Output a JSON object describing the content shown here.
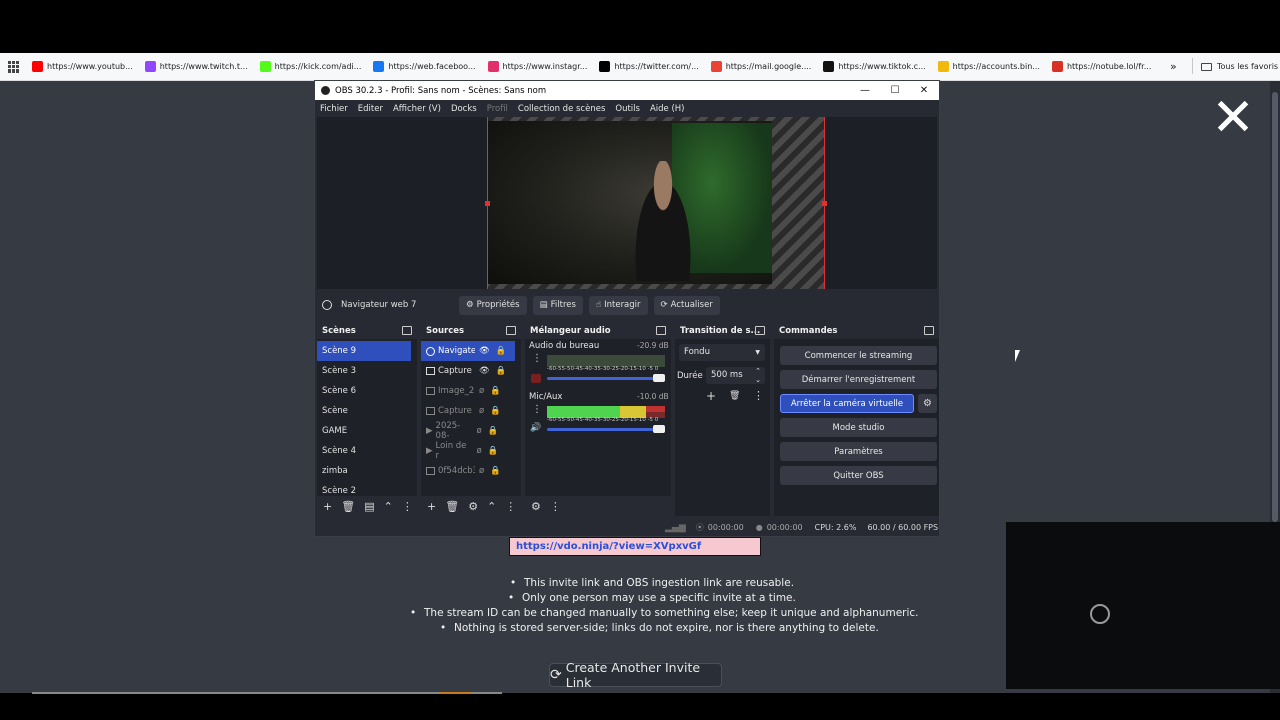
{
  "bookmarks": [
    {
      "label": "https://www.youtub...",
      "icon": "youtube-icon",
      "color": "#ff0000"
    },
    {
      "label": "https://www.twitch.t...",
      "icon": "twitch-icon",
      "color": "#9146ff"
    },
    {
      "label": "https://kick.com/adi...",
      "icon": "kick-icon",
      "color": "#53fc18"
    },
    {
      "label": "https://web.faceboo...",
      "icon": "facebook-icon",
      "color": "#1877f2"
    },
    {
      "label": "https://www.instagr...",
      "icon": "instagram-icon",
      "color": "#e1306c"
    },
    {
      "label": "https://twitter.com/...",
      "icon": "x-icon",
      "color": "#000000"
    },
    {
      "label": "https://mail.google....",
      "icon": "gmail-icon",
      "color": "#ea4335"
    },
    {
      "label": "https://www.tiktok.c...",
      "icon": "tiktok-icon",
      "color": "#111111"
    },
    {
      "label": "https://accounts.bin...",
      "icon": "binance-icon",
      "color": "#f0b90b"
    },
    {
      "label": "https://notube.lol/fr...",
      "icon": "notube-icon",
      "color": "#d93025"
    }
  ],
  "bookmarks_more": "»",
  "all_bookmarks": "Tous les favoris",
  "obs": {
    "title": "OBS 30.2.3 - Profil: Sans nom - Scènes: Sans nom",
    "menu": [
      "Fichier",
      "Editer",
      "Afficher (V)",
      "Docks",
      "Profil",
      "Collection de scènes",
      "Outils",
      "Aide (H)"
    ],
    "source_name": "Navigateur web 7",
    "source_buttons": {
      "properties": "Propriétés",
      "filters": "Filtres",
      "interact": "Interagir",
      "refresh": "Actualiser"
    },
    "scenes": {
      "title": "Scènes",
      "items": [
        "Scène 9",
        "Scène 3",
        "Scène 6",
        "Scène",
        "GAME",
        "Scène 4",
        "zimba",
        "Scène 2"
      ]
    },
    "sources": {
      "title": "Sources",
      "items": [
        "Navigate",
        "Capture",
        "Image_2",
        "Capture",
        "2025-08-",
        "Loin de r",
        "0f54dcb3"
      ]
    },
    "mixer": {
      "title": "Mélangeur audio",
      "channels": [
        {
          "name": "Audio du bureau",
          "db": "-20.9 dB",
          "level": 0.0
        },
        {
          "name": "Mic/Aux",
          "db": "-10.0 dB",
          "level": 0.88
        }
      ],
      "scale": "-60-55-50-45-40-35-30-25-20-15-10 -5  0"
    },
    "transitions": {
      "title": "Transition de s...",
      "selected": "Fondu",
      "duration_label": "Durée",
      "duration_value": "500 ms"
    },
    "controls": {
      "title": "Commandes",
      "start_stream": "Commencer le streaming",
      "start_record": "Démarrer l'enregistrement",
      "stop_virtualcam": "Arrêter la caméra virtuelle",
      "studio_mode": "Mode studio",
      "settings": "Paramètres",
      "exit": "Quitter OBS"
    },
    "status": {
      "stream_time": "00:00:00",
      "record_time": "00:00:00",
      "cpu": "CPU: 2.6%",
      "fps": "60.00 / 60.00 FPS"
    }
  },
  "page": {
    "link": "https://vdo.ninja/?view=XVpxvGf",
    "bullets": [
      "This invite link and OBS ingestion link are reusable.",
      "Only one person may use a specific invite at a time.",
      "The stream ID can be changed manually to something else; keep it unique and alphanumeric.",
      "Nothing is stored server-side; links do not expire, nor is there anything to delete."
    ],
    "create_button": "Create Another Invite Link",
    "close_symbol": "✕"
  }
}
